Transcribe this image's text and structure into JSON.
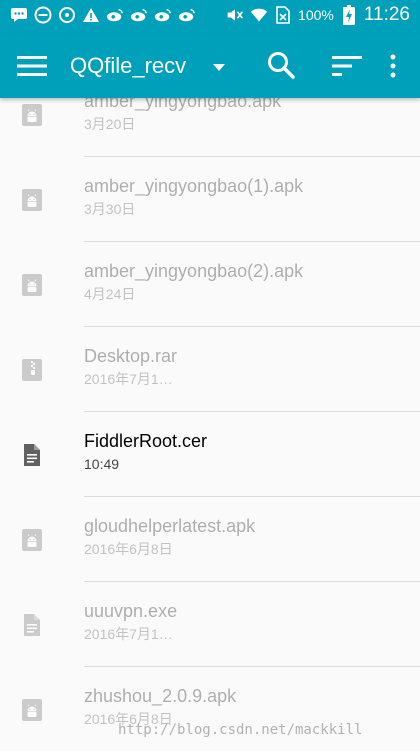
{
  "status_bar": {
    "battery": "100%",
    "time": "11:26"
  },
  "toolbar": {
    "title": "QQfile_recv"
  },
  "files": [
    {
      "name": "amber_yingyongbao.apk",
      "meta": "3月20日",
      "icon": "android-apk-icon",
      "enabled": false
    },
    {
      "name": "amber_yingyongbao(1).apk",
      "meta": "3月30日",
      "icon": "android-apk-icon",
      "enabled": false
    },
    {
      "name": "amber_yingyongbao(2).apk",
      "meta": "4月24日",
      "icon": "android-apk-icon",
      "enabled": false
    },
    {
      "name": "Desktop.rar",
      "meta": "2016年7月1…",
      "icon": "archive-icon",
      "enabled": false
    },
    {
      "name": "FiddlerRoot.cer",
      "meta": "10:49",
      "icon": "document-icon",
      "enabled": true
    },
    {
      "name": "gloudhelperlatest.apk",
      "meta": "2016年6月8日",
      "icon": "android-apk-icon",
      "enabled": false
    },
    {
      "name": "uuuvpn.exe",
      "meta": "2016年7月1…",
      "icon": "document-icon",
      "enabled": false
    },
    {
      "name": "zhushou_2.0.9.apk",
      "meta": "2016年6月8日",
      "icon": "android-apk-icon",
      "enabled": false
    }
  ],
  "watermark": "http://blog.csdn.net/mackkill",
  "colors": {
    "primary": "#00a0ba",
    "background": "#fafafa"
  }
}
